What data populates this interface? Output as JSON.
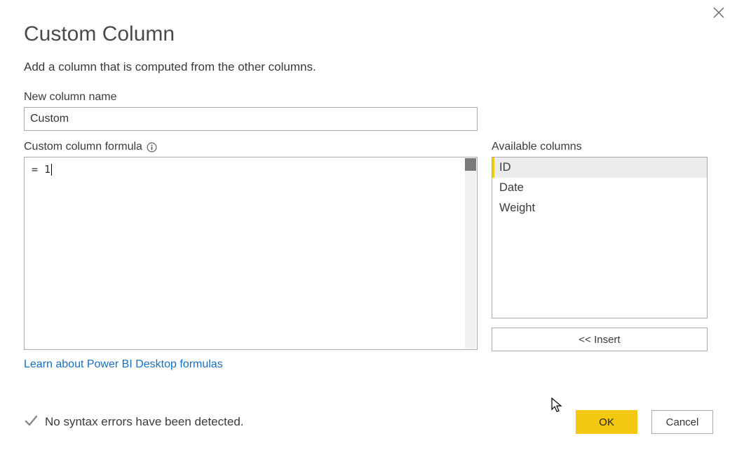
{
  "dialog": {
    "title": "Custom Column",
    "subtitle": "Add a column that is computed from the other columns."
  },
  "name_field": {
    "label": "New column name",
    "value": "Custom"
  },
  "formula_field": {
    "label": "Custom column formula",
    "value": "= 1"
  },
  "columns": {
    "label": "Available columns",
    "items": [
      "ID",
      "Date",
      "Weight"
    ],
    "selected_index": 0,
    "insert_label": "<< Insert"
  },
  "learn_link": "Learn about Power BI Desktop formulas",
  "status": {
    "message": "No syntax errors have been detected."
  },
  "buttons": {
    "ok": "OK",
    "cancel": "Cancel"
  }
}
